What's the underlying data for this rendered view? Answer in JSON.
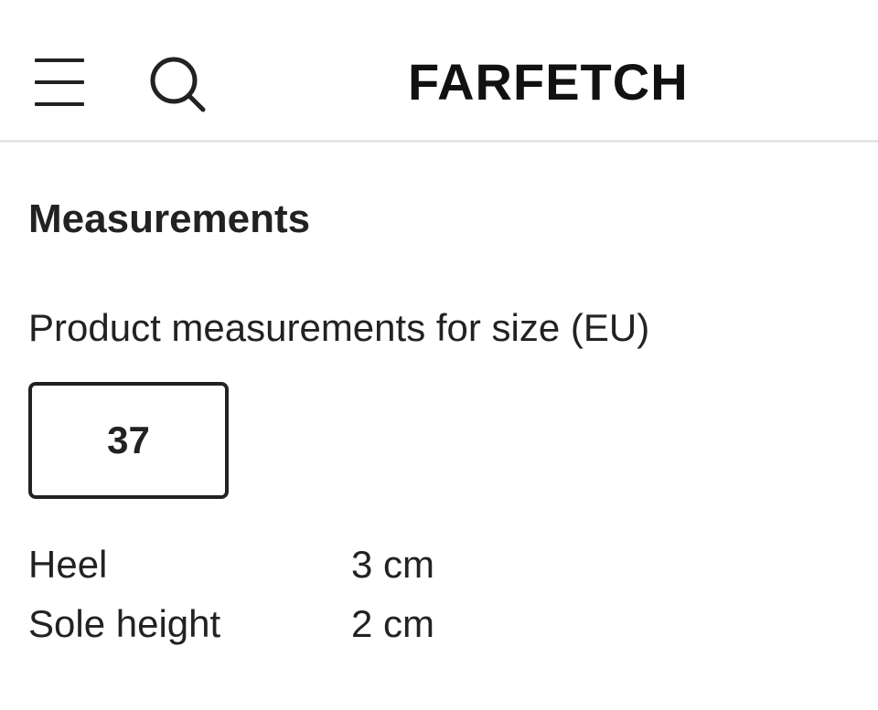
{
  "header": {
    "menu_icon": "hamburger-menu-icon",
    "search_icon": "search-icon",
    "logo_text": "FARFETCH"
  },
  "measurements": {
    "title": "Measurements",
    "size_caption": "Product measurements for size (EU)",
    "selected_size": "37",
    "rows": [
      {
        "label": "Heel",
        "value": "3 cm"
      },
      {
        "label": "Sole height",
        "value": "2 cm"
      }
    ]
  },
  "colors": {
    "text": "#222222",
    "divider": "#e6e6e6",
    "background": "#ffffff"
  }
}
